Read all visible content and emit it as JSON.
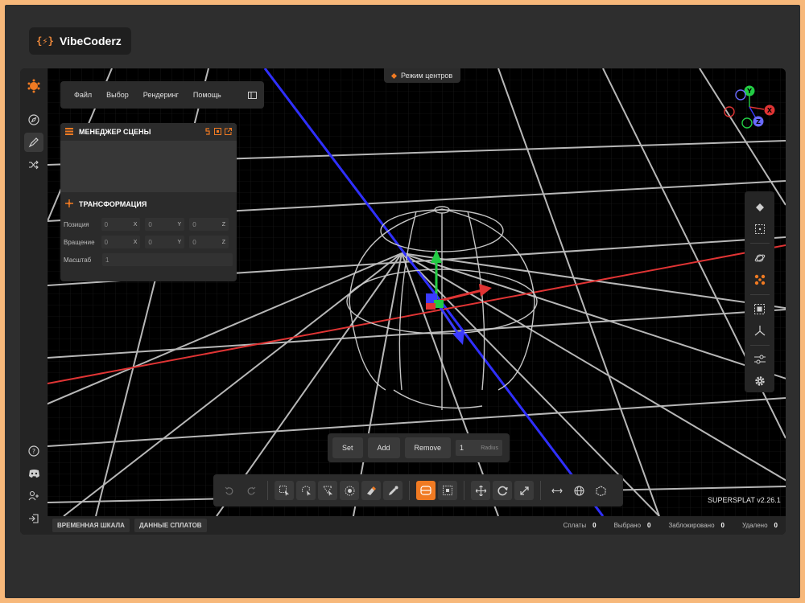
{
  "brand": {
    "name": "VibeCoderz",
    "logo_glyph": "{⚡}"
  },
  "colors": {
    "accent": "#f07a22",
    "axis_x": "#e03434",
    "axis_y": "#22cc44",
    "axis_z": "#3b3bff"
  },
  "menubar": {
    "items": [
      "Файл",
      "Выбор",
      "Рендеринг",
      "Помощь"
    ]
  },
  "centers_mode": {
    "label": "Режим центров"
  },
  "scene_manager": {
    "title": "МЕНЕДЖЕР СЦЕНЫ"
  },
  "transform": {
    "title": "ТРАНСФОРМАЦИЯ",
    "position": {
      "label": "Позиция",
      "x": "0",
      "y": "0",
      "z": "0"
    },
    "rotation": {
      "label": "Вращение",
      "x": "0",
      "y": "0",
      "z": "0"
    },
    "scale": {
      "label": "Масштаб",
      "value": "1"
    },
    "axis_labels": {
      "x": "X",
      "y": "Y",
      "z": "Z"
    }
  },
  "selection_tools": {
    "set": "Set",
    "add": "Add",
    "remove": "Remove",
    "radius_value": "1",
    "radius_label": "Radius"
  },
  "gizmo": {
    "x": "X",
    "y": "Y",
    "z": "Z"
  },
  "version": "SUPERSPLAT v2.26.1",
  "statusbar": {
    "tabs": [
      "ВРЕМЕННАЯ ШКАЛА",
      "ДАННЫЕ СПЛАТОВ"
    ],
    "stats": [
      {
        "label": "Сплаты",
        "value": "0"
      },
      {
        "label": "Выбрано",
        "value": "0"
      },
      {
        "label": "Заблокировано",
        "value": "0"
      },
      {
        "label": "Удалено",
        "value": "0"
      }
    ]
  }
}
